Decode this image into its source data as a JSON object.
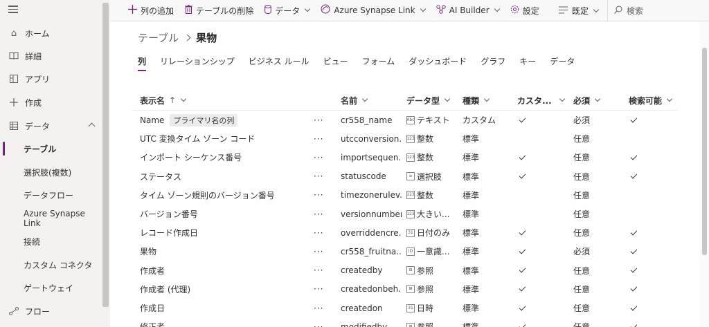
{
  "sidebar": {
    "items": [
      {
        "label": "ホーム",
        "icon": "home-icon"
      },
      {
        "label": "詳細",
        "icon": "book-icon"
      },
      {
        "label": "アプリ",
        "icon": "apps-icon"
      },
      {
        "label": "作成",
        "icon": "plus-icon"
      },
      {
        "label": "データ",
        "icon": "table-icon"
      }
    ],
    "sub_items": [
      {
        "label": "テーブル",
        "active": true
      },
      {
        "label": "選択肢(複数)"
      },
      {
        "label": "データフロー"
      },
      {
        "label": "Azure Synapse Link"
      },
      {
        "label": "接続"
      },
      {
        "label": "カスタム コネクタ"
      },
      {
        "label": "ゲートウェイ"
      }
    ],
    "flow": {
      "label": "フロー",
      "icon": "flow-icon"
    }
  },
  "cmdbar": {
    "add_column": "列の追加",
    "delete_table": "テーブルの削除",
    "data": "データ",
    "synapse": "Azure Synapse Link",
    "ai_builder": "AI Builder",
    "settings": "設定",
    "view": "既定",
    "search_placeholder": "検索"
  },
  "breadcrumb": {
    "parent": "テーブル",
    "current": "果物"
  },
  "tabs": [
    "列",
    "リレーションシップ",
    "ビジネス ルール",
    "ビュー",
    "フォーム",
    "ダッシュボード",
    "グラフ",
    "キー",
    "データ"
  ],
  "table": {
    "headers": {
      "display_name": "表示名",
      "sort_indicator": "↑",
      "name": "名前",
      "data_type": "データ型",
      "kind": "種類",
      "custom": "カスタ...",
      "required": "必須",
      "searchable": "検索可能"
    },
    "primary_badge": "プライマリ名の列",
    "row_menu": "···",
    "rows": [
      {
        "display": "Name",
        "name": "cr558_name",
        "type_icon": "Abc",
        "type": "テキスト",
        "kind": "カスタム",
        "custom": true,
        "required": "必須",
        "searchable": true,
        "primary": true
      },
      {
        "display": "UTC 変換タイム ゾーン コード",
        "name": "utcconversion...",
        "type_icon": "123",
        "type": "整数",
        "kind": "標準",
        "custom": false,
        "required": "任意",
        "searchable": false
      },
      {
        "display": "インポート シーケンス番号",
        "name": "importsequen...",
        "type_icon": "123",
        "type": "整数",
        "kind": "標準",
        "custom": true,
        "required": "任意",
        "searchable": true
      },
      {
        "display": "ステータス",
        "name": "statuscode",
        "type_icon": "≡",
        "type": "選択肢",
        "kind": "標準",
        "custom": true,
        "required": "任意",
        "searchable": true
      },
      {
        "display": "タイム ゾーン規則のバージョン番号",
        "name": "timezonerulev...",
        "type_icon": "123",
        "type": "整数",
        "kind": "標準",
        "custom": false,
        "required": "任意",
        "searchable": false
      },
      {
        "display": "バージョン番号",
        "name": "versionnumber",
        "type_icon": "123",
        "type": "大きい...",
        "kind": "標準",
        "custom": false,
        "required": "任意",
        "searchable": false
      },
      {
        "display": "レコード作成日",
        "name": "overriddencre...",
        "type_icon": "31",
        "type": "日付のみ",
        "kind": "標準",
        "custom": true,
        "required": "任意",
        "searchable": true
      },
      {
        "display": "果物",
        "name": "cr558_fruitna...",
        "type_icon": "ID",
        "type": "一意識...",
        "kind": "標準",
        "custom": true,
        "required": "必須",
        "searchable": true
      },
      {
        "display": "作成者",
        "name": "createdby",
        "type_icon": "⊞",
        "type": "参照",
        "kind": "標準",
        "custom": true,
        "required": "任意",
        "searchable": true
      },
      {
        "display": "作成者 (代理)",
        "name": "createdonbeh...",
        "type_icon": "⊞",
        "type": "参照",
        "kind": "標準",
        "custom": true,
        "required": "任意",
        "searchable": true
      },
      {
        "display": "作成日",
        "name": "createdon",
        "type_icon": "31",
        "type": "日時",
        "kind": "標準",
        "custom": true,
        "required": "任意",
        "searchable": true
      },
      {
        "display": "修正者",
        "name": "modifiedby",
        "type_icon": "⊞",
        "type": "参照",
        "kind": "標準",
        "custom": true,
        "required": "任意",
        "searchable": true
      }
    ]
  },
  "colors": {
    "accent": "#742774",
    "sidebar_bg": "#f3f2f1",
    "cmdbar_bg": "#f8f8f8"
  }
}
